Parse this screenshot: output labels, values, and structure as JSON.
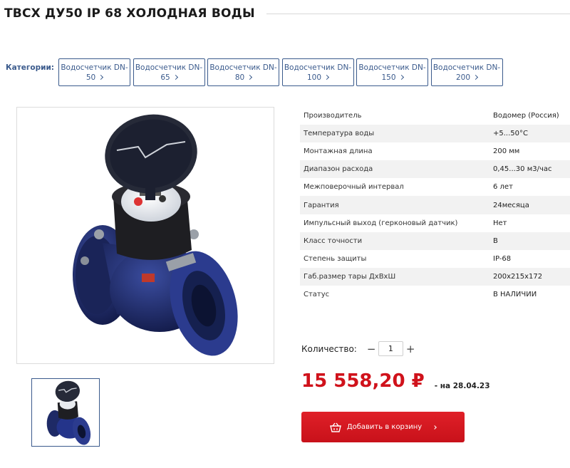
{
  "page": {
    "title": "ТВСХ ДУ50 IP 68 ХОЛОДНАЯ ВОДЫ"
  },
  "categories": {
    "label": "Категории:",
    "items": [
      {
        "line1": "Водосчетчик DN-",
        "line2": "50"
      },
      {
        "line1": "Водосчетчик DN-",
        "line2": "65"
      },
      {
        "line1": "Водосчетчик DN-",
        "line2": "80"
      },
      {
        "line1": "Водосчетчик DN-",
        "line2": "100"
      },
      {
        "line1": "Водосчетчик DN-",
        "line2": "150"
      },
      {
        "line1": "Водосчетчик DN-",
        "line2": "200"
      }
    ]
  },
  "specs": [
    {
      "key": "Производитель",
      "value": "Водомер (Россия)"
    },
    {
      "key": "Температура воды",
      "value": "+5...50°С"
    },
    {
      "key": "Монтажная длина",
      "value": "200 мм"
    },
    {
      "key": "Диапазон расхода",
      "value": "0,45...30 м3/час"
    },
    {
      "key": "Межповерочный интервал",
      "value": "6 лет"
    },
    {
      "key": "Гарантия",
      "value": "24месяца"
    },
    {
      "key": "Импульсный выход (герконовый датчик)",
      "value": "Нет"
    },
    {
      "key": "Класс точности",
      "value": "В"
    },
    {
      "key": "Степень защиты",
      "value": "IP-68"
    },
    {
      "key": "Габ.размер тары ДхВхШ",
      "value": "200х215х172"
    },
    {
      "key": "Статус",
      "value": "В НАЛИЧИИ"
    }
  ],
  "quantity": {
    "label": "Количество:",
    "minus": "−",
    "value": "1",
    "plus": "+"
  },
  "price": {
    "amount": "15 558,20 ₽",
    "date_note": "- на 28.04.23",
    "color": "#d0121b"
  },
  "cart": {
    "label": "Добавить в корзину",
    "icon": "basket-icon",
    "color": "#d0121b"
  },
  "theme": {
    "accent": "#3a5a8c",
    "meter_body": "#22306e"
  }
}
